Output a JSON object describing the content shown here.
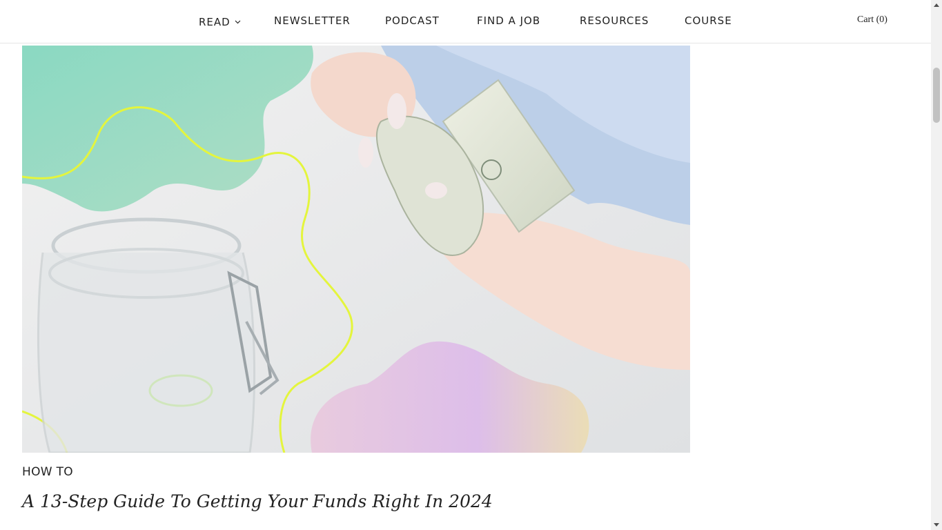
{
  "nav": {
    "items": [
      {
        "label": "READ",
        "has_dropdown": true
      },
      {
        "label": "NEWSLETTER"
      },
      {
        "label": "PODCAST"
      },
      {
        "label": "FIND A JOB"
      },
      {
        "label": "RESOURCES"
      },
      {
        "label": "COURSE"
      }
    ],
    "cart_label": "Cart (0)"
  },
  "article": {
    "image_alt": "Hands counting rolled dollar bills next to an empty glass jar",
    "category": "HOW TO",
    "title": "A 13-Step Guide To Getting Your Funds Right In 2024"
  },
  "colors": {
    "accent_green": "#7fd6bd",
    "accent_lime": "#e4f53d",
    "accent_lilac": "#e0b8e8"
  }
}
